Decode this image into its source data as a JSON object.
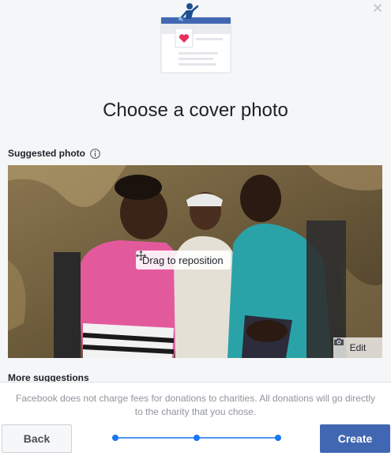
{
  "dialog": {
    "title": "Choose a cover photo"
  },
  "suggested": {
    "label": "Suggested photo",
    "drag_hint": "Drag to reposition",
    "edit_label": "Edit"
  },
  "more_suggestions": {
    "label": "More suggestions"
  },
  "footer": {
    "note": "Facebook does not charge fees for donations to charities. All donations will go directly to the charity that you chose.",
    "back_label": "Back",
    "create_label": "Create"
  },
  "progress": {
    "steps": 3,
    "current_step": 3
  },
  "colors": {
    "accent": "#4267b2",
    "progress": "#1877f2",
    "heart": "#e8305a"
  },
  "icons": {
    "close": "close-icon",
    "info": "info-icon",
    "move": "move-icon",
    "camera": "camera-icon"
  }
}
